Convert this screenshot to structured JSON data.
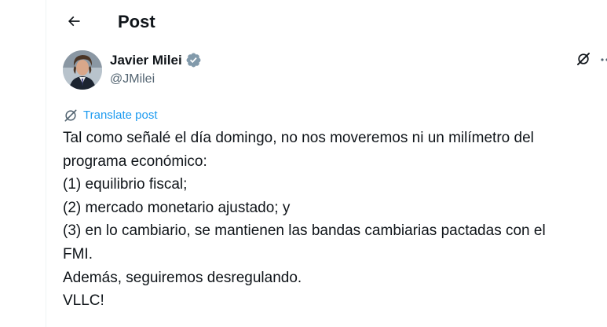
{
  "header": {
    "back_icon": "arrow-left-icon",
    "title": "Post"
  },
  "author": {
    "name": "Javier Milei",
    "handle": "@JMilei",
    "verified": true,
    "verified_color": "#829aab",
    "avatar_icon": "avatar-photo"
  },
  "actions": {
    "grok_icon": "grok-icon",
    "more_icon": "more-icon"
  },
  "translate": {
    "label": "Translate post",
    "color": "#1d9bf0"
  },
  "post": {
    "lines": [
      "Tal como señalé el día domingo, no nos moveremos ni un milímetro del",
      "programa económico:",
      "(1) equilibrio fiscal;",
      "(2) mercado monetario ajustado; y",
      "(3) en lo cambiario, se mantienen las bandas cambiarias pactadas con el",
      "FMI.",
      "Además, seguiremos desregulando.",
      "VLLC!"
    ]
  }
}
